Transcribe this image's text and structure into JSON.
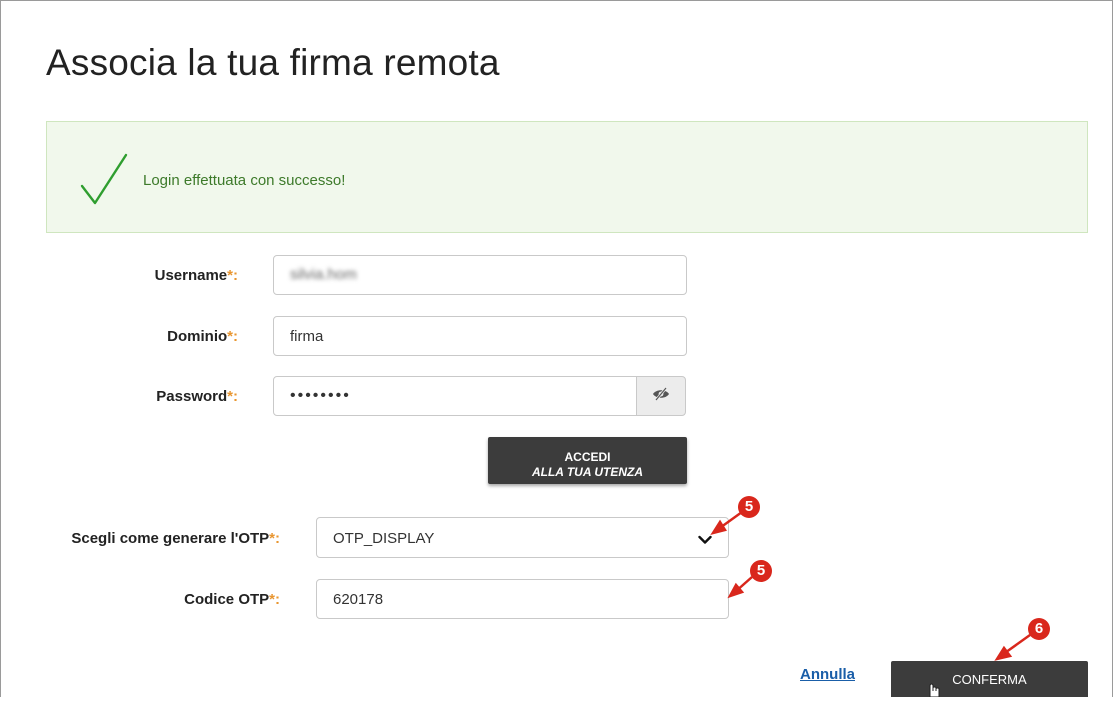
{
  "page": {
    "title": "Associa la tua firma remota"
  },
  "alert": {
    "message": "Login effettuata con successo!",
    "status_color": "#3d7a2a",
    "icon": "checkmark-icon"
  },
  "form": {
    "required_mark": "*:",
    "username": {
      "label": "Username",
      "value": "silvia.hom"
    },
    "domain": {
      "label": "Dominio",
      "value": "firma"
    },
    "password": {
      "label": "Password",
      "value": "••••••••",
      "toggle_icon": "eye-slash-icon"
    },
    "login_button": {
      "line1": "ACCEDI",
      "line2": "ALLA TUA UTENZA"
    },
    "otp_method": {
      "label": "Scegli come generare l'OTP",
      "value": "OTP_DISPLAY"
    },
    "otp_code": {
      "label": "Codice OTP",
      "value": "620178"
    }
  },
  "footer": {
    "cancel_label": "Annulla",
    "confirm_label": "CONFERMA"
  },
  "annotations": {
    "marker_otp_method": "5",
    "marker_otp_code": "5",
    "marker_confirm": "6",
    "color": "#d9271c"
  }
}
